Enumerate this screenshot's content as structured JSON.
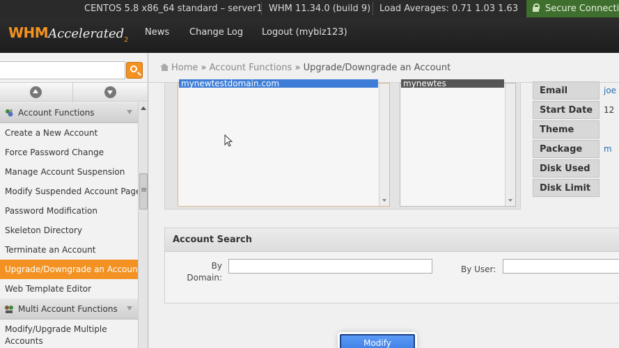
{
  "status_bar": {
    "os": "CENTOS 5.8 x86_64 standard – server1",
    "version": "WHM 11.34.0 (build 9)",
    "load": "Load Averages: 0.71 1.03 1.63",
    "secure": "Secure Connection"
  },
  "header": {
    "logo_main": "WHM",
    "logo_accent": "Accelerated",
    "logo_sup": "2",
    "nav": [
      "News",
      "Change Log",
      "Logout (mybiz123)"
    ]
  },
  "sidebar": {
    "search_placeholder": "",
    "sections": [
      {
        "title": "Account Functions",
        "items": [
          "Create a New Account",
          "Force Password Change",
          "Manage Account Suspension",
          "Modify Suspended Account Page",
          "Password Modification",
          "Skeleton Directory",
          "Terminate an Account",
          "Upgrade/Downgrade an Account",
          "Web Template Editor"
        ],
        "active_index": 7
      },
      {
        "title": "Multi Account Functions",
        "items": [
          "Modify/Upgrade Multiple Accounts"
        ]
      }
    ]
  },
  "breadcrumb": {
    "home": "Home",
    "sep": "»",
    "section": "Account Functions",
    "current": "Upgrade/Downgrade an Account"
  },
  "lists": {
    "domain_selected": "mynewtestdomain.com",
    "user_selected": "mynewtes"
  },
  "info": [
    {
      "label": "Email",
      "value": "joe",
      "link": true
    },
    {
      "label": "Start Date",
      "value": "12",
      "link": false
    },
    {
      "label": "Theme",
      "value": "",
      "link": false
    },
    {
      "label": "Package",
      "value": "m",
      "link": true
    },
    {
      "label": "Disk Used",
      "value": "",
      "link": false
    },
    {
      "label": "Disk Limit",
      "value": "",
      "link": false
    }
  ],
  "account_search": {
    "title": "Account Search",
    "by_domain_label": "By Domain:",
    "by_user_label": "By User:"
  },
  "modify_button": "Modify",
  "colors": {
    "accent": "#f39222",
    "selection": "#3d7dd8",
    "secure": "#3f6f2f"
  }
}
